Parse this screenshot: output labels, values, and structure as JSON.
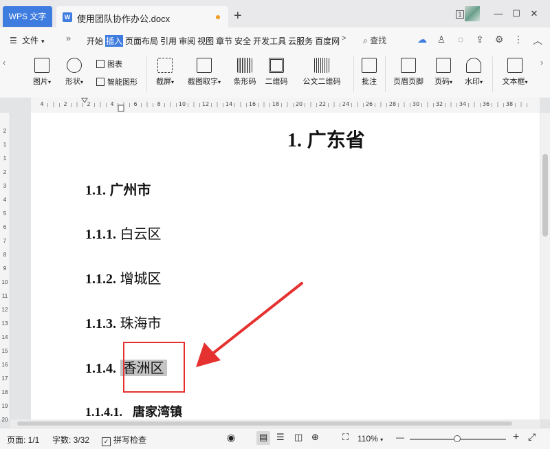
{
  "titlebar": {
    "app_tab": "WPS 文字",
    "doc_tab": "使用团队协作办公.docx",
    "new_tab": "+",
    "window_badge": "1",
    "minimize": "—",
    "maximize": "☐",
    "close": "✕"
  },
  "menubar": {
    "file": "文件",
    "more": "»",
    "tabs": [
      "开始",
      "插入",
      "页面布局",
      "引用",
      "审阅",
      "视图",
      "章节",
      "安全",
      "开发工具",
      "云服务",
      "百度网"
    ],
    "active_tab": "插入",
    "scroll": ">",
    "search": "查找"
  },
  "ribbon": {
    "picture": "图片",
    "shape": "形状",
    "chart": "图表",
    "smart_graphic": "智能图形",
    "screenshot": "截屏",
    "screenshot_text": "截图取字",
    "barcode": "条形码",
    "qrcode": "二维码",
    "doc_qrcode": "公文二维码",
    "comment": "批注",
    "header_footer": "页眉页脚",
    "page_number": "页码",
    "watermark": "水印",
    "textbox": "文本框"
  },
  "ruler": {
    "h_labels": [
      "4",
      "2",
      "2",
      "4",
      "6",
      "8",
      "10",
      "12",
      "14",
      "16",
      "18",
      "20",
      "22",
      "24",
      "26",
      "28",
      "30",
      "32",
      "34",
      "36",
      "38"
    ],
    "v_labels": [
      "2",
      "1",
      "1",
      "2",
      "3",
      "4",
      "5",
      "6",
      "7",
      "8",
      "9",
      "10",
      "11",
      "12",
      "13",
      "14",
      "15",
      "16",
      "17",
      "18",
      "19",
      "20"
    ]
  },
  "document": {
    "h1": {
      "num": "1.",
      "text": "广东省"
    },
    "h1_1": {
      "num": "1.1.",
      "text": "广州市"
    },
    "h1_1_1": {
      "num": "1.1.1.",
      "text": "白云区"
    },
    "h1_1_2": {
      "num": "1.1.2.",
      "text": "增城区"
    },
    "h1_1_3": {
      "num": "1.1.3.",
      "text": "珠海市"
    },
    "h1_1_4": {
      "num": "1.1.4.",
      "text": "香洲区"
    },
    "h1_1_4_1": {
      "num": "1.1.4.1.",
      "text": "唐家湾镇"
    }
  },
  "statusbar": {
    "page": "页面: 1/1",
    "words": "字数: 3/32",
    "spellcheck": "拼写检查",
    "zoom": "110%",
    "zoom_out": "—",
    "zoom_in": "+"
  },
  "colors": {
    "accent": "#3e7ce0",
    "annotation_red": "#e5312f",
    "selection_gray": "#c4c4c4"
  }
}
